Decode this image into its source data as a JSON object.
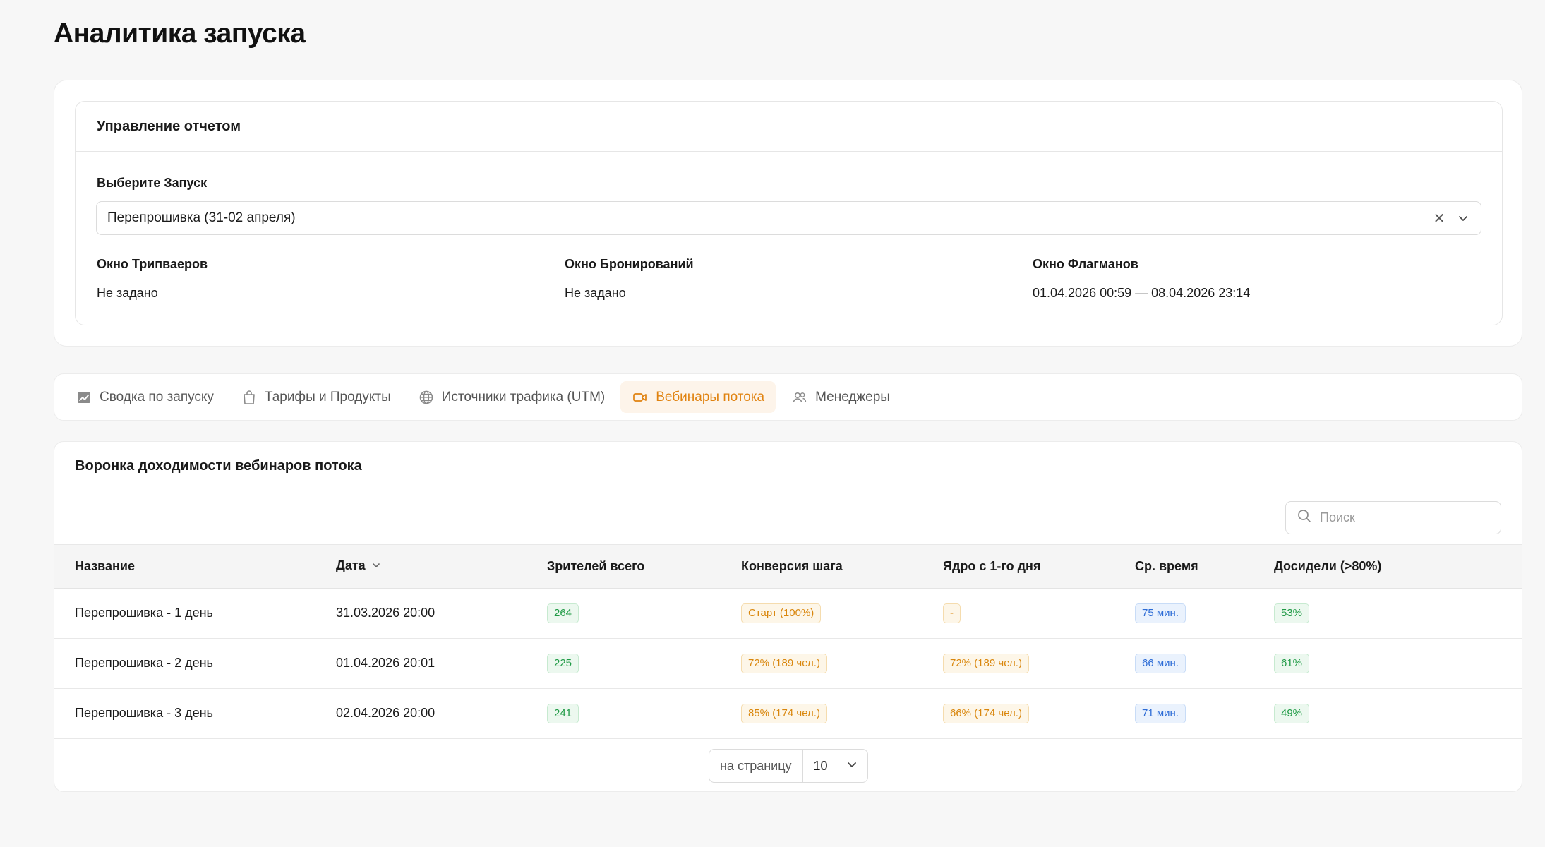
{
  "page": {
    "title": "Аналитика запуска"
  },
  "report": {
    "header": "Управление отчетом",
    "select_label": "Выберите Запуск",
    "select_value": "Перепрошивка (31-02 апреля)",
    "windows": [
      {
        "label": "Окно Трипваеров",
        "value": "Не задано"
      },
      {
        "label": "Окно Бронирований",
        "value": "Не задано"
      },
      {
        "label": "Окно Флагманов",
        "value": "01.04.2026 00:59 — 08.04.2026 23:14"
      }
    ]
  },
  "tabs": [
    {
      "label": "Сводка по запуску",
      "icon": "chart-icon",
      "active": false
    },
    {
      "label": "Тарифы и Продукты",
      "icon": "bag-icon",
      "active": false
    },
    {
      "label": "Источники трафика (UTM)",
      "icon": "globe-icon",
      "active": false
    },
    {
      "label": "Вебинары потока",
      "icon": "video-icon",
      "active": true
    },
    {
      "label": "Менеджеры",
      "icon": "users-icon",
      "active": false
    }
  ],
  "table": {
    "title": "Воронка доходимости вебинаров потока",
    "search_placeholder": "Поиск",
    "columns": [
      "Название",
      "Дата",
      "Зрителей всего",
      "Конверсия шага",
      "Ядро с 1-го дня",
      "Ср. время",
      "Досидели (>80%)"
    ],
    "rows": [
      {
        "name": "Перепрошивка - 1 день",
        "date": "31.03.2026 20:00",
        "viewers": "264",
        "conversion": "Старт (100%)",
        "core": "-",
        "avg_time": "75 мин.",
        "stayed": "53%"
      },
      {
        "name": "Перепрошивка - 2 день",
        "date": "01.04.2026 20:01",
        "viewers": "225",
        "conversion": "72% (189 чел.)",
        "core": "72% (189 чел.)",
        "avg_time": "66 мин.",
        "stayed": "61%"
      },
      {
        "name": "Перепрошивка - 3 день",
        "date": "02.04.2026 20:00",
        "viewers": "241",
        "conversion": "85% (174 чел.)",
        "core": "66% (174 чел.)",
        "avg_time": "71 мин.",
        "stayed": "49%"
      }
    ],
    "pager": {
      "label": "на страницу",
      "value": "10"
    }
  },
  "colors": {
    "accent": "#e0820f",
    "green": "#1f9a45",
    "orange": "#d9860c",
    "blue": "#2d6cd6"
  }
}
